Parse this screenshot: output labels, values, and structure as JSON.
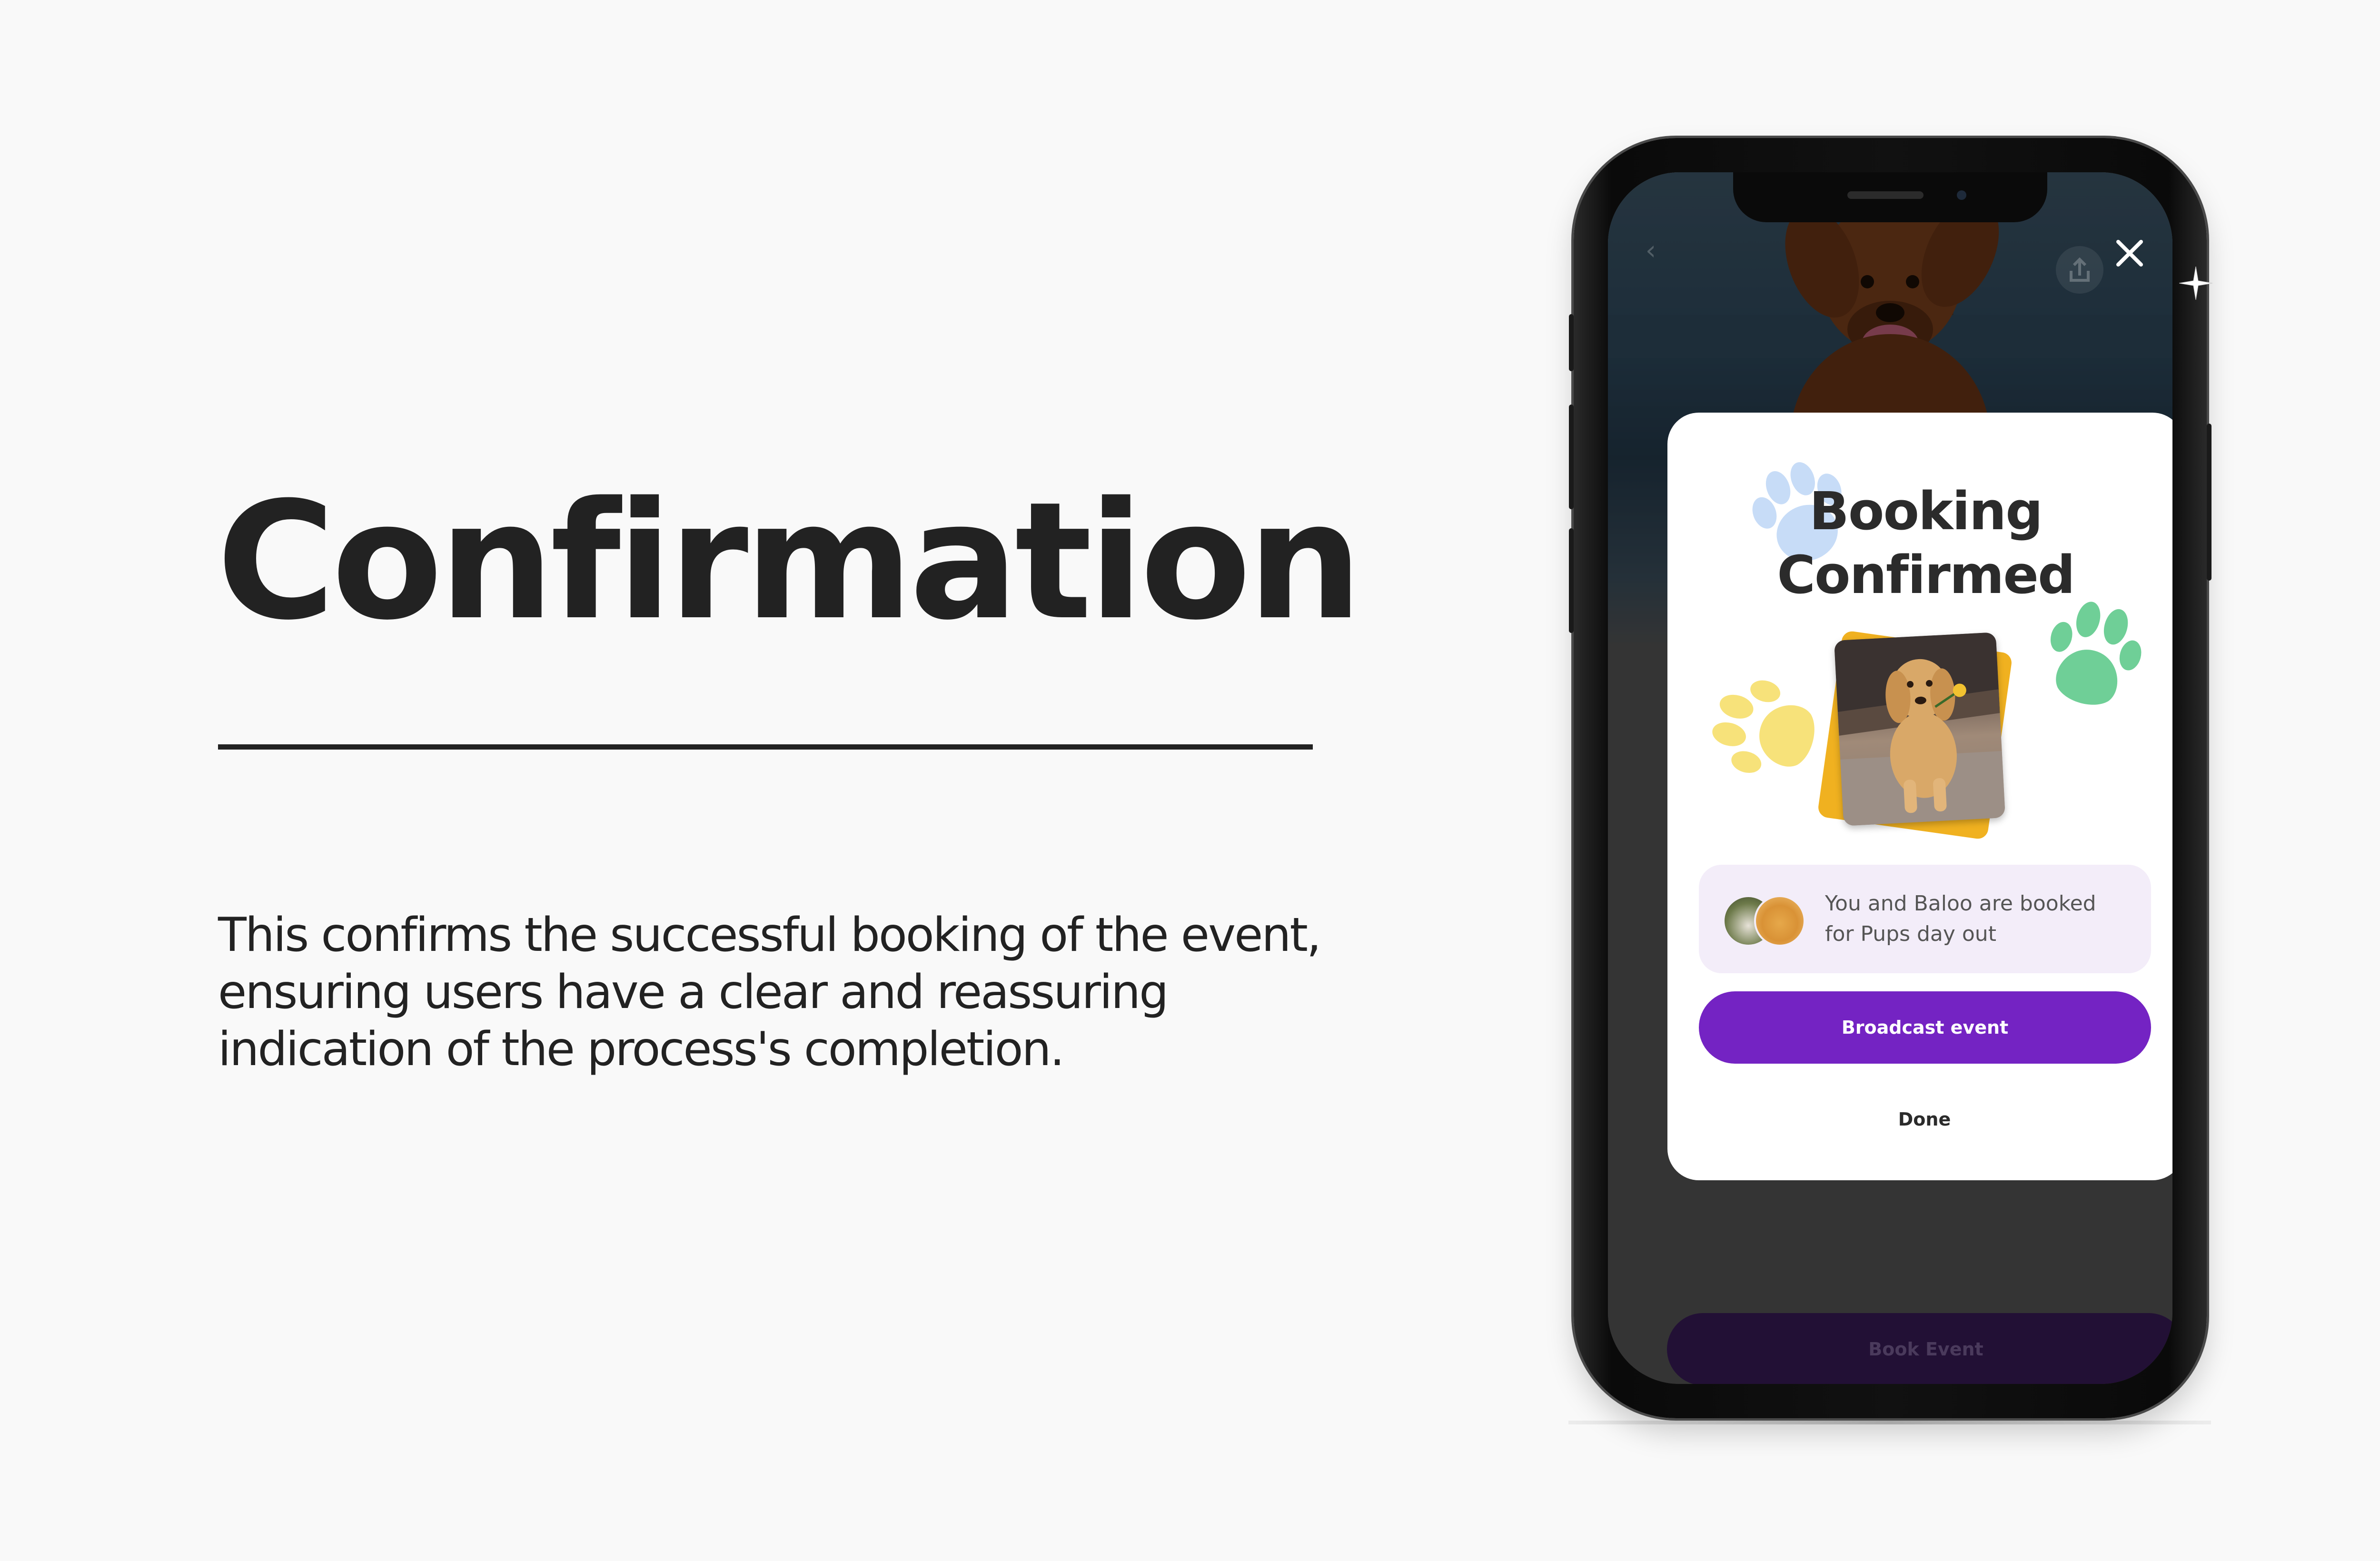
{
  "slide": {
    "heading": "Confirmation",
    "description": "This confirms the successful booking of the event, ensuring users have a clear and reassuring indication of the process's completion."
  },
  "modal": {
    "title": "Booking Confirmed",
    "info_text": "You and Baloo are booked for Pups day out",
    "primary_button": "Broadcast event",
    "secondary_button": "Done"
  },
  "footer": {
    "book_button": "Book Event"
  },
  "colors": {
    "accent": "#7423c3",
    "text_dark": "#222222",
    "info_bg": "#f3edf9",
    "paw_blue": "#c7dcf7",
    "paw_green": "#6fcf97",
    "paw_yellow": "#f7e27a",
    "card_yellow": "#f0b120"
  },
  "icons": [
    "back-arrow-icon",
    "share-icon",
    "close-icon",
    "paw-print-icon",
    "sparkle-icon"
  ]
}
